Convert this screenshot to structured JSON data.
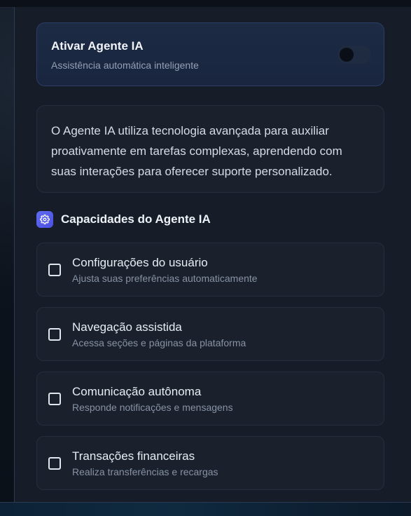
{
  "agent_toggle": {
    "title": "Ativar Agente IA",
    "subtitle": "Assistência automática inteligente",
    "enabled": false
  },
  "info": {
    "text": "O Agente IA utiliza tecnologia avançada para auxiliar proativamente em tarefas complexas, aprendendo com suas interações para oferecer suporte personalizado."
  },
  "capabilities": {
    "title": "Capacidades do Agente IA",
    "icon": "gear-icon",
    "accent": "#5b63ee",
    "items": [
      {
        "title": "Configurações do usuário",
        "description": "Ajusta suas preferências automaticamente",
        "checked": false
      },
      {
        "title": "Navegação assistida",
        "description": "Acessa seções e páginas da plataforma",
        "checked": false
      },
      {
        "title": "Comunicação autônoma",
        "description": "Responde notificações e mensagens",
        "checked": false
      },
      {
        "title": "Transações financeiras",
        "description": "Realiza transferências e recargas",
        "checked": false
      }
    ]
  }
}
